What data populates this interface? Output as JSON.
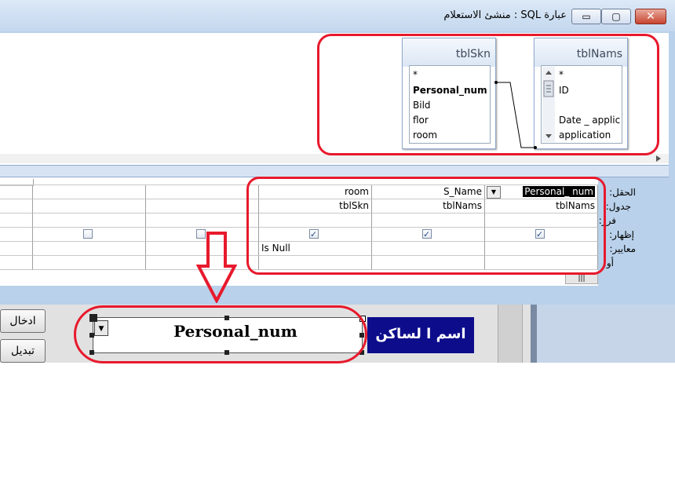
{
  "window": {
    "title": "عبارة SQL : منشئ الاستعلام",
    "minimize_glyph": "▭",
    "maximize_glyph": "▢",
    "close_glyph": "✕"
  },
  "tables": [
    {
      "name": "tblSkn",
      "fields": [
        "*",
        "Personal_num",
        "Bild",
        "flor",
        "room"
      ]
    },
    {
      "name": "tblNams",
      "fields": [
        "*",
        "ID",
        "Date _ applic",
        "application"
      ]
    }
  ],
  "grid": {
    "row_labels": [
      "الحقل:",
      "جدول:",
      "فرز:",
      "إظهار:",
      "معايير:",
      "أو:"
    ],
    "columns": [
      {
        "field": "Personal_ num",
        "table": "tblNams",
        "show": true,
        "criteria": "",
        "dropdown_glyph": "▼"
      },
      {
        "field": "S_Name",
        "table": "tblNams",
        "show": true,
        "criteria": ""
      },
      {
        "field": "room",
        "table": "tblSkn",
        "show": true,
        "criteria": "Is Null"
      },
      {
        "field": "",
        "table": "",
        "show": false,
        "criteria": ""
      },
      {
        "field": "",
        "table": "",
        "show": false,
        "criteria": ""
      }
    ],
    "scroll_glyph": "|||"
  },
  "form": {
    "button_insert": "ادخال",
    "button_change": "تبديل",
    "textbox_value": "Personal_num",
    "label": "اسم ا لساكن",
    "combo_glyph": "▼"
  },
  "colors": {
    "annotation_red": "#e8192c",
    "label_bg": "#0d0d8c"
  }
}
